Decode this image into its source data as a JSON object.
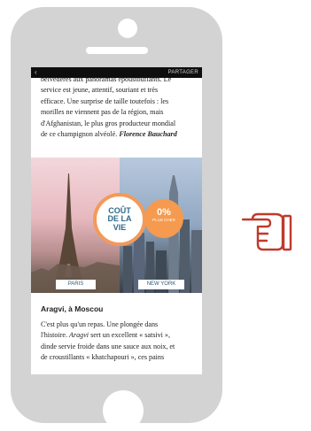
{
  "topbar": {
    "back": "‹",
    "share": "PARTAGER"
  },
  "intro_text": {
    "lines": [
      "belvédères aux panoramas époustouflants. Le",
      "service est jeune, attentif, souriant et très",
      "efficace. Une surprise de taille toutefois : les",
      "morilles ne viennent pas de la région, mais",
      "d'Afghanistan, le plus gros producteur mondial",
      "de ce champignon alvéolé."
    ],
    "author": "Florence Bauchard"
  },
  "graphic": {
    "badge_main": [
      "COÛT",
      "DE LA",
      "VIE"
    ],
    "badge_pct": "0%",
    "badge_pct_sub": "PLUS CHER",
    "label_left": "PARIS",
    "label_right": "NEW YORK"
  },
  "article": {
    "heading": "Aragvi, à Moscou",
    "line1": "C'est plus qu'un repas. Une plongée dans",
    "line2_prefix": "l'histoire. ",
    "line2_em": "Aragvi",
    "line2_suffix": " sert un excellent « satsivi »,",
    "line3": "dinde servie froide dans une sauce aux noix, et",
    "line4": "de croustillants « khatchapouri », ces pains"
  },
  "colors": {
    "accent_orange": "#f59a4e",
    "blue_text": "#2e6a88",
    "hand_red": "#c0392b"
  },
  "icons": {
    "pointer": "pointing-hand-icon"
  }
}
